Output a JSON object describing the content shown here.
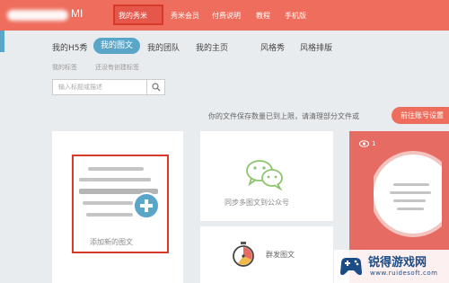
{
  "header": {
    "logo_text": "MI",
    "nav": [
      {
        "label": "我的秀米",
        "active": true
      },
      {
        "label": "秀米会员"
      },
      {
        "label": "付费说明"
      },
      {
        "label": "教程"
      },
      {
        "label": "手机版"
      }
    ]
  },
  "tabs": [
    {
      "label": "我的H5秀"
    },
    {
      "label": "我的图文",
      "active": true
    },
    {
      "label": "我的团队"
    },
    {
      "label": "我的主页"
    },
    {
      "label": "风格秀"
    },
    {
      "label": "风格排版"
    }
  ],
  "subtabs": [
    {
      "label": "我的标签"
    },
    {
      "label": "还没有创建标签"
    }
  ],
  "search": {
    "placeholder": "输入标题或描述"
  },
  "notice": {
    "text": "你的文件保存数量已到上限，请清理部分文件或",
    "button": "前往账号设置"
  },
  "cards": {
    "add_new": "添加新的图文",
    "sync": "同步多图文到公众号",
    "mass_send": "群发图文",
    "view_count": "1"
  },
  "watermark": {
    "title": "锐得游戏网",
    "url": "www.ruidesoft.com"
  },
  "colors": {
    "brand": "#ee6d5c",
    "accent": "#5aa6c9",
    "highlight_border": "#d83a2a"
  },
  "icons": [
    "search-icon",
    "wechat-icon",
    "timer-icon",
    "eye-icon",
    "plus-icon",
    "document-icon"
  ]
}
